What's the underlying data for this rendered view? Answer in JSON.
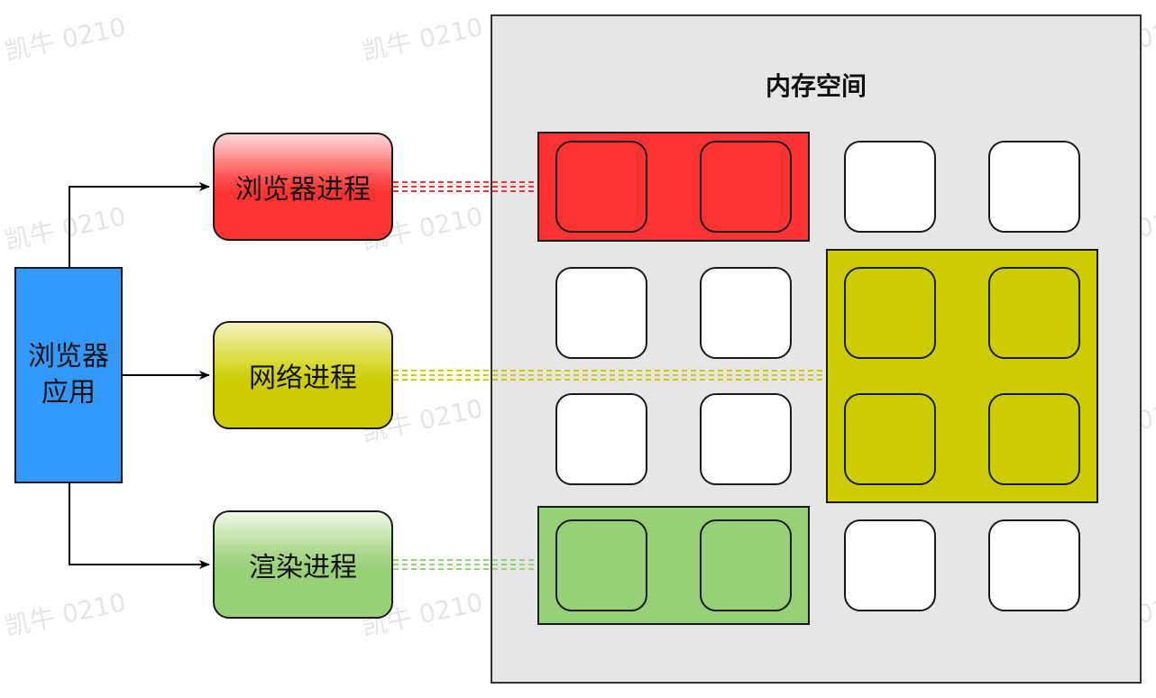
{
  "app": {
    "line1": "浏览器",
    "line2": "应用"
  },
  "processes": {
    "browser": "浏览器进程",
    "network": "网络进程",
    "render": "渲染进程"
  },
  "memory": {
    "title": "内存空间"
  },
  "watermark": "凯牛 0210",
  "colors": {
    "app": "#3399ff",
    "browser_process": "#ff3333",
    "network_process": "#cccc00",
    "render_process": "#97d077",
    "memory_bg": "#e6e6e6"
  },
  "grid": {
    "rows": [
      [
        "browser",
        "browser",
        "free",
        "free"
      ],
      [
        "free",
        "free",
        "network",
        "network"
      ],
      [
        "free",
        "free",
        "network",
        "network"
      ],
      [
        "render",
        "render",
        "free",
        "free"
      ]
    ]
  }
}
